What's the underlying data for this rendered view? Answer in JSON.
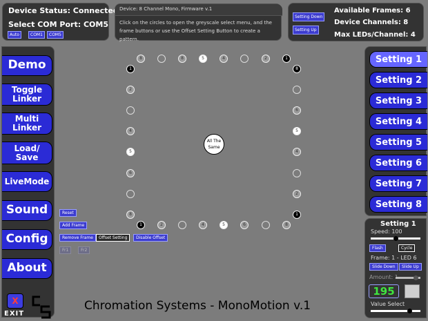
{
  "status": {
    "title": "Device Status: Connected",
    "port_label": "Select COM Port: COM5",
    "port_buttons": [
      "Auto",
      "COM1",
      "COM5"
    ]
  },
  "info": {
    "title": "Device: 8 Channel Mono, Firmware v.1",
    "body": "Click on the circles to open the greyscale select menu, and the frame buttons or use the Offset Setting Button to create a pattern."
  },
  "setting_nav": {
    "down": "Setting Down",
    "up": "Setting Up"
  },
  "device_stats": {
    "frames": "Available Frames: 6",
    "channels": "Device Channels: 8",
    "max_leds": "Max LEDs/Channel: 4"
  },
  "nav": [
    {
      "label": "Demo"
    },
    {
      "label": "Toggle Linker"
    },
    {
      "label": "Multi Linker"
    },
    {
      "label": "Load/ Save"
    },
    {
      "label": "LiveMode"
    },
    {
      "label": "Sound"
    },
    {
      "label": "Config"
    },
    {
      "label": "About"
    }
  ],
  "center_button": "All The Same",
  "edit_buttons": {
    "reset": "Reset",
    "add_frame": "Add Frame",
    "remove_frame": "Remove Frame",
    "offset_setting": "Offset Setting",
    "disable_offset": "Disable Offset",
    "f1": "Fr1",
    "f2": "Fr2"
  },
  "leds": {
    "top": [
      "8",
      "",
      "8",
      "5",
      "4",
      "",
      "2",
      "1"
    ],
    "right": [
      "8",
      "",
      "6",
      "5",
      "4",
      "",
      "2",
      "1"
    ],
    "bottom": [
      "1",
      "2",
      "",
      "4",
      "5",
      "6",
      "",
      "8"
    ],
    "left": [
      "1",
      "2",
      "",
      "4",
      "5",
      "6",
      "",
      "8"
    ]
  },
  "settings": [
    {
      "label": "Setting 1"
    },
    {
      "label": "Setting 2"
    },
    {
      "label": "Setting 3"
    },
    {
      "label": "Setting 4"
    },
    {
      "label": "Setting 5"
    },
    {
      "label": "Setting 6"
    },
    {
      "label": "Setting 7"
    },
    {
      "label": "Setting 8"
    }
  ],
  "setting_detail": {
    "title": "Setting 1",
    "speed": "Speed: 100",
    "speed_level": 0.5,
    "flash": "Flash",
    "cycle": "Cycle",
    "frame_led": "Frame: 1 - LED 6",
    "slide_down": "Slide Down",
    "slide_up": "Slide Up",
    "amount": "Amount: 1",
    "amount_level": 0.8,
    "value": "195",
    "value_select": "Value Select",
    "value_level": 0.78
  },
  "footer": {
    "title": "Chromation Systems - MonoMotion v.1",
    "exit": "EXIT",
    "x_logo": "X",
    "cs_logo": "CS"
  },
  "colors": {
    "button_blue": "#2b2bd6",
    "active_blue": "#6666ff",
    "panel": "#333333",
    "background": "#7c7c7c",
    "value_green": "#3fe63f"
  }
}
